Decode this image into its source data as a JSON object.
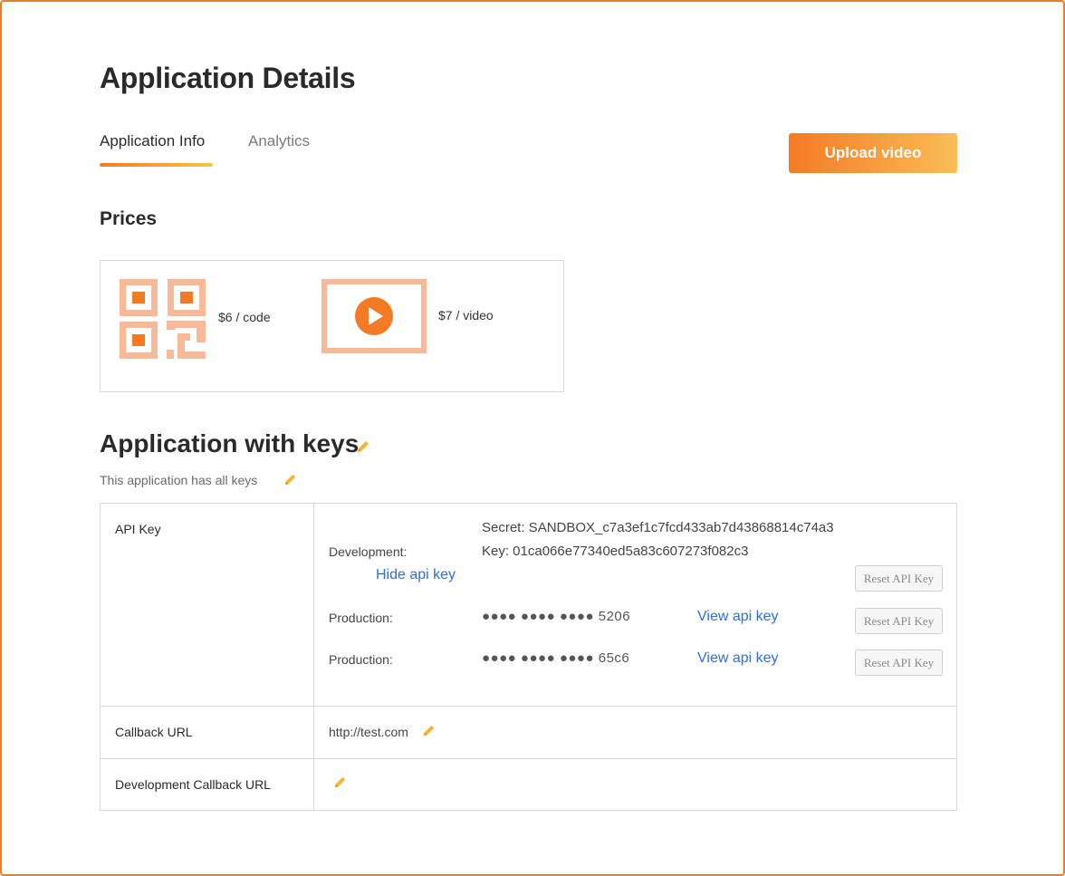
{
  "header": {
    "title": "Application Details"
  },
  "tabs": [
    {
      "label": "Application Info",
      "active": true
    },
    {
      "label": "Analytics",
      "active": false
    }
  ],
  "actions": {
    "upload_label": "Upload video"
  },
  "prices": {
    "heading": "Prices",
    "code_price": "$6 / code",
    "video_price": "$7 / video"
  },
  "keys_section": {
    "title": "Application with keys",
    "subtitle": "This application has all keys"
  },
  "api_keys": {
    "row_label": "API Key",
    "development": {
      "label": "Development:",
      "secret": "Secret: SANDBOX_c7a3ef1c7fcd433ab7d43868814c74a3",
      "key": "Key: 01ca066e77340ed5a83c607273f082c3",
      "toggle_label": "Hide api key",
      "reset_label": "Reset API Key"
    },
    "production": [
      {
        "label": "Production:",
        "masked": "●●●● ●●●● ●●●● 5206",
        "toggle_label": "View api key",
        "reset_label": "Reset API Key"
      },
      {
        "label": "Production:",
        "masked": "●●●● ●●●● ●●●● 65c6",
        "toggle_label": "View api key",
        "reset_label": "Reset API Key"
      }
    ]
  },
  "callback": {
    "label": "Callback URL",
    "value": "http://test.com"
  },
  "dev_callback": {
    "label": "Development Callback URL",
    "value": ""
  },
  "colors": {
    "accent_orange": "#f57a24",
    "accent_yellow": "#f9c24a",
    "icon_peach": "#f8b998",
    "link_blue": "#2f6fd6",
    "pencil_yellow": "#f5b533"
  },
  "icons": {
    "qr": "qr-code-icon",
    "video": "video-play-icon",
    "edit": "pencil-icon"
  }
}
